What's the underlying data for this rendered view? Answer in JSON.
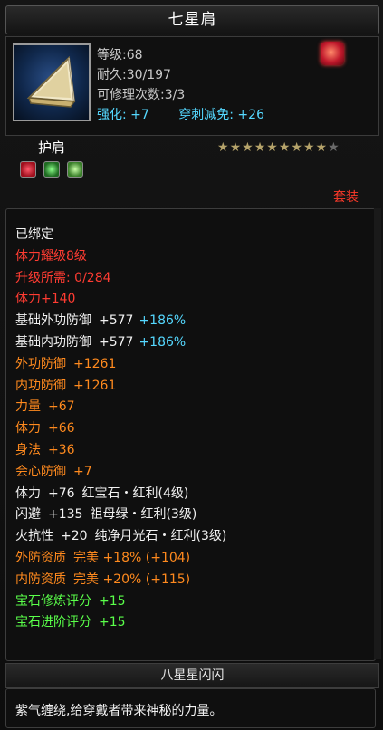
{
  "item": {
    "name": "七星肩",
    "level": "等级:68",
    "durability": "耐久:30/197",
    "repairs": "可修理次数:3/3",
    "enhance": "强化: +7",
    "pierce": "穿刺减免: +26",
    "type": "护肩",
    "star_count": 9,
    "star_total": 10,
    "tag": "套装"
  },
  "attributes": [
    {
      "label": "已绑定",
      "color": "white"
    },
    {
      "label": "体力耀级8级",
      "color": "red"
    },
    {
      "label": "升级所需: 0/284",
      "color": "red"
    },
    {
      "label": "体力+140",
      "color": "red"
    },
    {
      "label": "基础外功防御",
      "value": "+577",
      "extra": "+186%",
      "color": "white"
    },
    {
      "label": "基础内功防御",
      "value": "+577",
      "extra": "+186%",
      "color": "white"
    },
    {
      "label": "外功防御",
      "value": "+1261",
      "color": "orange"
    },
    {
      "label": "内功防御",
      "value": "+1261",
      "color": "orange"
    },
    {
      "label": "力量",
      "value": "+67",
      "color": "orange"
    },
    {
      "label": "体力",
      "value": "+66",
      "color": "orange"
    },
    {
      "label": "身法",
      "value": "+36",
      "color": "orange"
    },
    {
      "label": "会心防御",
      "value": "+7",
      "color": "orange"
    },
    {
      "label": "体力",
      "value": "+76",
      "gem": "红宝石・红利(4级)",
      "color": "white"
    },
    {
      "label": "闪避",
      "value": "+135",
      "gem": "祖母绿・红利(3级)",
      "color": "white"
    },
    {
      "label": "火抗性",
      "value": "+20",
      "gem": "纯净月光石・红利(3级)",
      "color": "white"
    },
    {
      "label": "外防资质",
      "value": "完美 +18% (+104)",
      "color": "orange"
    },
    {
      "label": "内防资质",
      "value": "完美 +20% (+115)",
      "color": "orange"
    },
    {
      "label": "宝石修炼评分",
      "value": "+15",
      "color": "green"
    },
    {
      "label": "宝石进阶评分",
      "value": "+15",
      "color": "green"
    }
  ],
  "footer": {
    "title": "八星星闪闪",
    "description": "紫气缠绕,给穿戴者带来神秘的力量。"
  }
}
